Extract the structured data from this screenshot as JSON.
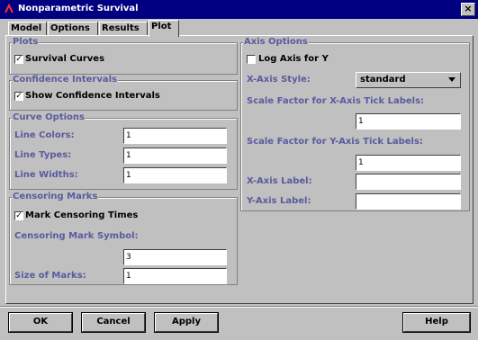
{
  "window": {
    "title": "Nonparametric Survival",
    "close_glyph": "×"
  },
  "tabs": [
    {
      "label": "Model"
    },
    {
      "label": "Options"
    },
    {
      "label": "Results"
    },
    {
      "label": "Plot"
    }
  ],
  "plots": {
    "title": "Plots",
    "survival_curves": {
      "label": "Survival Curves",
      "checked": true
    }
  },
  "confidence": {
    "title": "Confidence Intervals",
    "show": {
      "label": "Show Confidence Intervals",
      "checked": true
    }
  },
  "curve_options": {
    "title": "Curve Options",
    "line_colors": {
      "label": "Line Colors:",
      "value": "1"
    },
    "line_types": {
      "label": "Line Types:",
      "value": "1"
    },
    "line_widths": {
      "label": "Line Widths:",
      "value": "1"
    }
  },
  "censoring": {
    "title": "Censoring Marks",
    "mark_times": {
      "label": "Mark Censoring Times",
      "checked": true
    },
    "symbol": {
      "label": "Censoring Mark Symbol:",
      "value": "3"
    },
    "size": {
      "label": "Size of Marks:",
      "value": "1"
    }
  },
  "axis": {
    "title": "Axis Options",
    "log_y": {
      "label": "Log Axis for Y",
      "checked": false
    },
    "x_style": {
      "label": "X-Axis Style:",
      "value": "standard"
    },
    "x_scale": {
      "label": "Scale Factor for X-Axis Tick Labels:",
      "value": "1"
    },
    "y_scale": {
      "label": "Scale Factor for Y-Axis Tick Labels:",
      "value": "1"
    },
    "x_label": {
      "label": "X-Axis Label:",
      "value": ""
    },
    "y_label": {
      "label": "Y-Axis Label:",
      "value": ""
    }
  },
  "buttons": {
    "ok": "OK",
    "cancel": "Cancel",
    "apply": "Apply",
    "help": "Help"
  },
  "check_glyph": "✓"
}
